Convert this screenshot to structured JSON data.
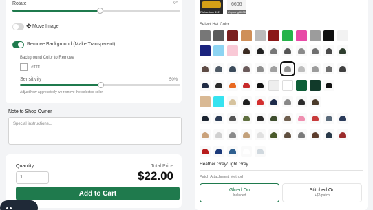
{
  "editor": {
    "rotate_label": "Rotate",
    "rotate_value": "0°",
    "rotate_level": 0.52,
    "move_image_label": "Move Image",
    "remove_bg_label": "Remove Background (Make Transparent)",
    "bg_color_label": "Background Color to Remove",
    "bg_color_value": "#ffffff",
    "sensitivity_label": "Sensitivity",
    "sensitivity_value": "50%",
    "sensitivity_level": 0.5,
    "sensitivity_help": "Adjust how aggressively we remove the selected color."
  },
  "note": {
    "label": "Note to Shop Owner",
    "placeholder": "Special instructions..."
  },
  "purchase": {
    "quantity_label": "Quantity",
    "quantity_value": "1",
    "total_label": "Total Price",
    "total_value": "$22.00",
    "add_to_cart_label": "Add to Cart"
  },
  "product": {
    "thumbnails": [
      {
        "caption": "Richardson 112"
      },
      {
        "code": "6606",
        "caption": "Yupoong 6606"
      }
    ],
    "select_color_label": "Select Hat Color",
    "selected_color_name": "Heather Grey/Light Grey",
    "patch_method_label": "Patch Attachment Method",
    "patch_options": [
      {
        "label": "Glued On",
        "sub": "Included",
        "selected": true
      },
      {
        "label": "Stitched On",
        "sub": "+$2/patch",
        "selected": false
      }
    ],
    "swatch_rows": [
      [
        "#777777",
        "#5a5a5a",
        "#7a1f1f",
        "#cf8f58",
        "#bbbbbb",
        "#8b1717",
        "#26b34a",
        "#e84aa7",
        "#9c9c9c",
        "#111111",
        "#f2f2f2"
      ],
      [
        "#1a237e",
        "#8dd4f2",
        "#f9c9d6",
        "#hat:#3b2b22",
        "#hat:#222222",
        "#hat:#777777",
        "#hat:#555555",
        "#hat:#8a8a8a",
        "#hat:#6f6f6f",
        "#hat:#4a4a4a",
        "#hat:#2e3d2e"
      ],
      [
        "#hat:#5e4b45",
        "#hat:#4f5a66",
        "#hat:#3a4a5a",
        "#hat:#6a5a5a",
        "#hat:#8e8e8e",
        "#hat:#a0a0a0",
        "#hat:#909090",
        "#hat:#bdbdbd",
        "#hat:#9b9b9b",
        "#hat:#6f6f6f",
        "#hat:#3f3f3f"
      ],
      [
        "#hat:#1f2b44",
        "#hat:#2a2a2a",
        "#hat:#e8681f",
        "#hat:#c62828",
        "#hat:#111111",
        "#eeeeee",
        "#ffffff",
        "#0e5e38",
        "#113a2a",
        "#hat:#111111",
        ""
      ],
      [
        "#d9b994",
        "#36e3f0",
        "#hat:#d6c39e",
        "#hat:#1e1e1e",
        "#hat:#d32f2f",
        "#hat:#1d2b4a",
        "#hat:#888888",
        "#hat:#2c2c2c",
        "#hat:#4a3a2a",
        "",
        ""
      ],
      [
        "#hat:#1b2430",
        "#hat:#2b3b55",
        "#hat:#555555",
        "#hat:#5f6f3f",
        "#hat:#2b2b2b",
        "#hat:#3e4e2e",
        "#hat:#6f5f4f",
        "#hat:#ef8fb0",
        "#hat:#c73b3b",
        "#hat:#5a6a7a",
        "#hat:#2a3a5a"
      ],
      [
        "#hat:#c9a17a",
        "#hat:#d0d0d0",
        "#hat:#8a8a8a",
        "#hat:#c2a07a",
        "#hat:#e0e0e0",
        "#hat:#4a5a2a",
        "#hat:#5e4e3e",
        "#hat:#7a7a7a",
        "#hat:#5b3b2b",
        "#hat:#283848",
        "#hat:#9a2a2a"
      ],
      [
        "#hat:#b71c1c",
        "#hat:#1c3a7a",
        "#hat:#2f5f8f",
        "#hat:#ffffff",
        "#hat:#d0d8de",
        "",
        "",
        "",
        "",
        "",
        ""
      ]
    ]
  }
}
